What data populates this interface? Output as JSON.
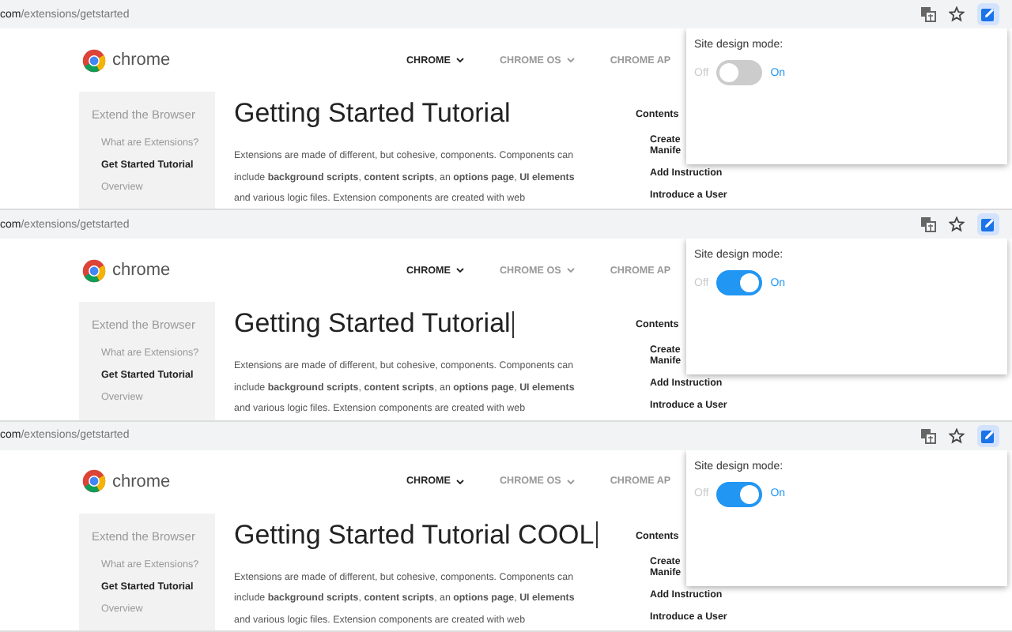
{
  "panels": [
    {
      "url_host": "com",
      "url_path": "/extensions/getstarted",
      "logo_text": "chrome",
      "nav": [
        {
          "label": "CHROME",
          "selected": true
        },
        {
          "label": "CHROME OS",
          "selected": false
        },
        {
          "label": "CHROME AP",
          "selected": false
        }
      ],
      "sidebar": {
        "title": "Extend the Browser",
        "items": [
          {
            "label": "What are Extensions?",
            "selected": false
          },
          {
            "label": "Get Started Tutorial",
            "selected": true
          },
          {
            "label": "Overview",
            "selected": false
          }
        ]
      },
      "heading": "Getting Started Tutorial",
      "heading_caret": false,
      "paragraph_lines": [
        "Extensions are made of different, but cohesive, components. Components can",
        "include **background scripts**, **content scripts**, an **options page**, **UI elements**",
        "and various logic files. Extension components are created with web"
      ],
      "toc": {
        "title": "Contents",
        "items": [
          "Create\nManife",
          "Add Instruction",
          "Introduce a User"
        ]
      },
      "popup": {
        "label": "Site design mode:",
        "off_label": "Off",
        "on_label": "On",
        "on": false
      }
    },
    {
      "url_host": "com",
      "url_path": "/extensions/getstarted",
      "logo_text": "chrome",
      "nav": [
        {
          "label": "CHROME",
          "selected": true
        },
        {
          "label": "CHROME OS",
          "selected": false
        },
        {
          "label": "CHROME AP",
          "selected": false
        }
      ],
      "sidebar": {
        "title": "Extend the Browser",
        "items": [
          {
            "label": "What are Extensions?",
            "selected": false
          },
          {
            "label": "Get Started Tutorial",
            "selected": true
          },
          {
            "label": "Overview",
            "selected": false
          }
        ]
      },
      "heading": "Getting Started Tutorial",
      "heading_caret": true,
      "paragraph_lines": [
        "Extensions are made of different, but cohesive, components. Components can",
        "include **background scripts**, **content scripts**, an **options page**, **UI elements**",
        "and various logic files. Extension components are created with web"
      ],
      "toc": {
        "title": "Contents",
        "items": [
          "Create\nManife",
          "Add Instruction",
          "Introduce a User"
        ]
      },
      "popup": {
        "label": "Site design mode:",
        "off_label": "Off",
        "on_label": "On",
        "on": true
      }
    },
    {
      "url_host": "com",
      "url_path": "/extensions/getstarted",
      "logo_text": "chrome",
      "nav": [
        {
          "label": "CHROME",
          "selected": true
        },
        {
          "label": "CHROME OS",
          "selected": false
        },
        {
          "label": "CHROME AP",
          "selected": false
        }
      ],
      "sidebar": {
        "title": "Extend the Browser",
        "items": [
          {
            "label": "What are Extensions?",
            "selected": false
          },
          {
            "label": "Get Started Tutorial",
            "selected": true
          },
          {
            "label": "Overview",
            "selected": false
          }
        ]
      },
      "heading": "Getting Started Tutorial COOL",
      "heading_caret": true,
      "paragraph_lines": [
        "Extensions are made of different, but cohesive, components. Components can",
        "include **background scripts**, **content scripts**, an **options page**, **UI elements**",
        "and various logic files. Extension components are created with web"
      ],
      "toc": {
        "title": "Contents",
        "items": [
          "Create\nManife",
          "Add Instruction",
          "Introduce a User"
        ]
      },
      "popup": {
        "label": "Site design mode:",
        "off_label": "Off",
        "on_label": "On",
        "on": true
      }
    }
  ]
}
